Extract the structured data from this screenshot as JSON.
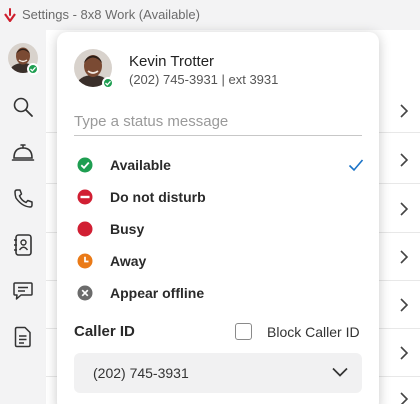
{
  "window": {
    "title": "Settings - 8x8 Work (Available)"
  },
  "rail": {
    "items": [
      {
        "name": "avatar",
        "icon": "avatar-icon"
      },
      {
        "name": "search",
        "icon": "search-icon"
      },
      {
        "name": "bell",
        "icon": "concierge-bell-icon"
      },
      {
        "name": "phone",
        "icon": "phone-icon"
      },
      {
        "name": "contacts",
        "icon": "contacts-icon"
      },
      {
        "name": "chat",
        "icon": "chat-icon"
      },
      {
        "name": "document",
        "icon": "document-icon"
      }
    ]
  },
  "profile": {
    "name": "Kevin Trotter",
    "phone": "(202) 745-3931 | ext 3931",
    "status_color": "#1e9e51"
  },
  "status_message": {
    "placeholder": "Type a status message",
    "value": ""
  },
  "status_options": [
    {
      "label": "Available",
      "icon": "available-check-icon",
      "color": "#1e9e51",
      "selected": true
    },
    {
      "label": "Do not disturb",
      "icon": "do-not-disturb-icon",
      "color": "#d11f33",
      "selected": false
    },
    {
      "label": "Busy",
      "icon": "busy-icon",
      "color": "#d11f33",
      "selected": false
    },
    {
      "label": "Away",
      "icon": "away-clock-icon",
      "color": "#ea7a17",
      "selected": false
    },
    {
      "label": "Appear offline",
      "icon": "offline-x-icon",
      "color": "#6b6b6b",
      "selected": false
    }
  ],
  "caller_id": {
    "label": "Caller ID",
    "block_label": "Block Caller ID",
    "block_checked": false,
    "selected_number": "(202) 745-3931"
  },
  "colors": {
    "accent": "#1a73c7",
    "brand": "#cf1f2e"
  }
}
